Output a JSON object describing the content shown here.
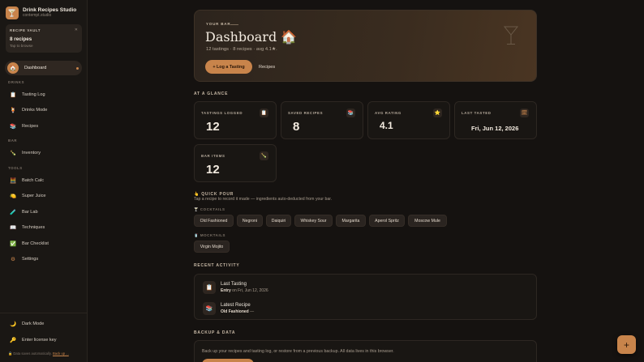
{
  "brand": {
    "title": "Drink Recipes Studio",
    "subtitle": "contempt.studio"
  },
  "vault": {
    "label": "RECIPE VAULT",
    "count": "8 recipes",
    "hint": "Tap to browse"
  },
  "sidebar": {
    "active": {
      "label": "Dashboard",
      "icon": "home-icon"
    },
    "sections": {
      "drinks": "DRINKS",
      "bar": "BAR",
      "tools": "TOOLS"
    },
    "items": [
      {
        "label": "Tasting Log",
        "icon": "clipboard-icon"
      },
      {
        "label": "Drinks Mode",
        "icon": "cocktail-icon"
      },
      {
        "label": "Recipes",
        "icon": "books-icon"
      },
      {
        "label": "Inventory",
        "icon": "bottle-icon"
      },
      {
        "label": "Batch Calc",
        "icon": "calculator-icon"
      },
      {
        "label": "Super Juice",
        "icon": "lemon-icon"
      },
      {
        "label": "Bar Lab",
        "icon": "test-tube-icon"
      },
      {
        "label": "Techniques",
        "icon": "book-icon"
      },
      {
        "label": "Bar Checklist",
        "icon": "checkbox-icon"
      },
      {
        "label": "Settings",
        "icon": "gear-icon"
      }
    ],
    "bottom": [
      {
        "label": "Dark Mode",
        "icon": "moon-icon"
      },
      {
        "label": "Enter license key",
        "icon": "key-icon"
      }
    ],
    "footer": {
      "text": "Data saves automatically.",
      "link": "Back up ..."
    }
  },
  "hero": {
    "eyebrow": "YOUR BAR",
    "title": "Dashboard 🏠",
    "summary": "12 tastings · 8 recipes · avg 4.1★.",
    "primary_button": "+ Log a Tasting",
    "secondary_button": "Recipes"
  },
  "glance": {
    "title": "AT A GLANCE",
    "stats": [
      {
        "label": "TASTINGS LOGGED",
        "value": "12",
        "icon": "clipboard-icon"
      },
      {
        "label": "SAVED RECIPES",
        "value": "8",
        "icon": "books-icon"
      },
      {
        "label": "AVG RATING",
        "value": "4.1",
        "icon": "star-icon"
      },
      {
        "label": "LAST TASTED",
        "value": "Fri, Jun 12, 2026",
        "icon": "calendar-icon"
      },
      {
        "label": "BAR ITEMS",
        "value": "12",
        "icon": "bottle-icon"
      }
    ]
  },
  "quick_pour": {
    "title": "QUICK POUR",
    "subtitle": "Tap a recipe to record it made — ingredients auto-deducted from your bar.",
    "cocktails_label": "COCKTAILS",
    "cocktails": [
      "Old Fashioned",
      "Negroni",
      "Daiquiri",
      "Whiskey Sour",
      "Margarita",
      "Aperol Spritz",
      "Moscow Mule"
    ],
    "mocktails_label": "MOCKTAILS",
    "mocktails": [
      "Virgin Mojito"
    ]
  },
  "activity": {
    "title": "RECENT ACTIVITY",
    "rows": [
      {
        "title": "Last Tasting",
        "bold": "Entry",
        "rest": " on Fri, Jun 12, 2026",
        "icon": "clipboard-icon"
      },
      {
        "title": "Latest Recipe",
        "bold": "Old Fashioned",
        "rest": " —",
        "icon": "books-icon"
      }
    ]
  },
  "backup": {
    "title": "BACKUP & DATA",
    "text": "Back up your recipes and tasting log, or restore from a previous backup. All data lives in this browser."
  },
  "fab": {
    "label": "+"
  },
  "colors": {
    "accent": "#c8844b",
    "background": "#151210",
    "card": "#191613"
  }
}
